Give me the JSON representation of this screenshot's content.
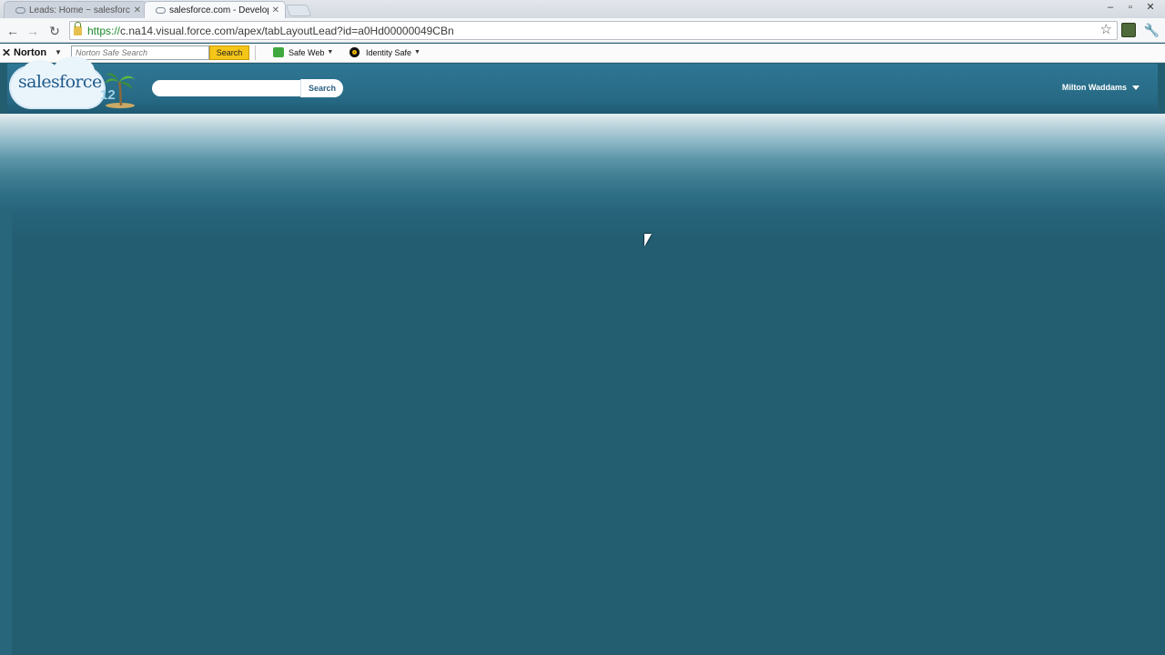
{
  "browser": {
    "tabs": [
      {
        "label": "Leads: Home ~ salesforce.c",
        "active": false
      },
      {
        "label": "salesforce.com - Develope",
        "active": true
      }
    ],
    "url_scheme": "https://",
    "url_rest": "c.na14.visual.force.com/apex/tabLayoutLead?id=a0Hd00000049CBn",
    "window_controls": [
      "–",
      "▫",
      "✕"
    ]
  },
  "norton": {
    "logo": "Norton",
    "search_placeholder": "Norton Safe Search",
    "search_button": "Search",
    "safe_web": "Safe Web",
    "identity_safe": "Identity Safe"
  },
  "salesforce": {
    "logo_text": "salesforce",
    "release_number": "12",
    "search_button": "Search",
    "user_name": "Milton Waddams"
  },
  "colors": {
    "header": "#2b7190",
    "content": "#235d70",
    "norton_search_button": "#f5c518"
  }
}
